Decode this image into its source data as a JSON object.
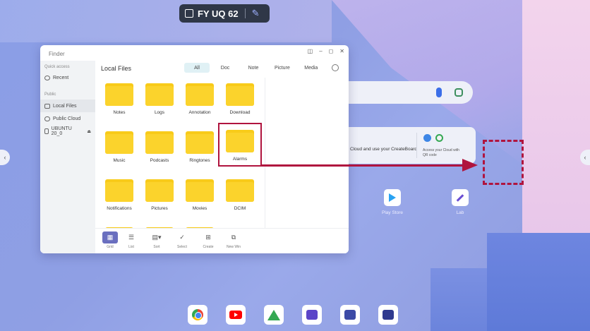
{
  "header": {
    "room_code": "FY UQ 62"
  },
  "finder": {
    "title": "Finder",
    "section_title": "Local Files",
    "window_controls": [
      "◫",
      "–",
      "◻",
      "✕"
    ],
    "sidebar": {
      "quick_access_label": "Quick access",
      "recent_label": "Recent",
      "public_label": "Public",
      "items": [
        {
          "label": "Local Files",
          "active": true
        },
        {
          "label": "Public Cloud",
          "active": false
        },
        {
          "label": "UBUNTU 20_0",
          "active": false
        }
      ]
    },
    "tabs": [
      {
        "label": "All",
        "active": true
      },
      {
        "label": "Doc",
        "active": false
      },
      {
        "label": "Note",
        "active": false
      },
      {
        "label": "Picture",
        "active": false
      },
      {
        "label": "Media",
        "active": false
      }
    ],
    "folders": [
      "Notes",
      "Logs",
      "Annotation",
      "Download",
      "Music",
      "Podcasts",
      "Ringtones",
      "Alarms",
      "Notifications",
      "Pictures",
      "Movies",
      "DCIM"
    ],
    "highlighted_folder": "Alarms",
    "toolbar": [
      {
        "label": "Grid",
        "icon": "grid-icon",
        "active": true
      },
      {
        "label": "List",
        "icon": "list-icon",
        "active": false
      },
      {
        "label": "Sort",
        "icon": "sort-icon",
        "active": false
      },
      {
        "label": "Select",
        "icon": "check-circle-icon",
        "active": false
      },
      {
        "label": "Create",
        "icon": "folder-plus-icon",
        "active": false
      },
      {
        "label": "New Win",
        "icon": "new-window-icon",
        "active": false
      }
    ]
  },
  "background": {
    "share_text": "Cloud and use your CreateBoard",
    "share_sub": "Access your Cloud with QR code"
  },
  "apps": [
    {
      "label": "Play Store",
      "icon": "play-store-icon"
    },
    {
      "label": "Lab",
      "icon": "lab-icon"
    }
  ],
  "dock": [
    "chrome-icon",
    "youtube-icon",
    "google-drive-icon",
    "whiteboard-icon",
    "screen-share-icon",
    "files-icon"
  ],
  "colors": {
    "accent": "#b0143e",
    "folder": "#fbd32c",
    "active_tool": "#6a6fbf",
    "active_tab": "#e0f1f5"
  }
}
